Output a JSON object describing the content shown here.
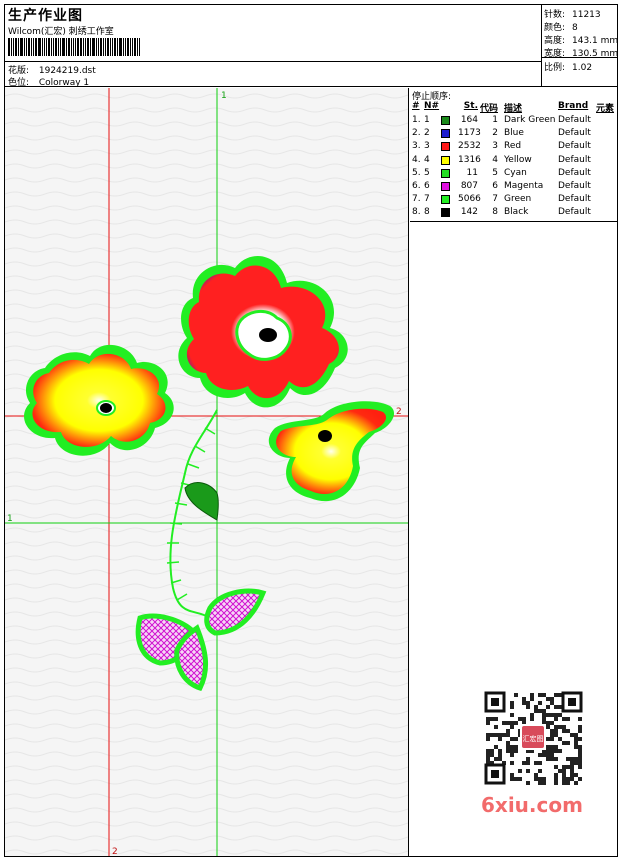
{
  "header": {
    "title": "生产作业图",
    "studio": "Wilcom(汇宏) 刺绣工作室",
    "design_label": "花版:",
    "design_value": "1924219.dst",
    "colorway_label": "色位:",
    "colorway_value": "Colorway 1"
  },
  "stats": [
    {
      "label": "针数:",
      "value": "11213"
    },
    {
      "label": "颜色:",
      "value": "8"
    },
    {
      "label": "高度:",
      "value": "143.1 mm"
    },
    {
      "label": "宽度:",
      "value": "130.5 mm"
    },
    {
      "label": "比例:",
      "value": "1.02"
    }
  ],
  "stop_sequence": {
    "title": "停止顺序:",
    "columns": {
      "hash": "#",
      "n": "N#",
      "st": "St.",
      "code": "代码",
      "desc": "描述",
      "brand": "Brand",
      "elem": "元素"
    },
    "rows": [
      {
        "idx": "1.",
        "n": "1",
        "color": "#1a8a1a",
        "st": "164",
        "code": "1",
        "desc": "Dark Green",
        "brand": "Default"
      },
      {
        "idx": "2.",
        "n": "2",
        "color": "#1c1ccf",
        "st": "1173",
        "code": "2",
        "desc": "Blue",
        "brand": "Default"
      },
      {
        "idx": "3.",
        "n": "3",
        "color": "#ff1a1a",
        "st": "2532",
        "code": "3",
        "desc": "Red",
        "brand": "Default"
      },
      {
        "idx": "4.",
        "n": "4",
        "color": "#ffff00",
        "st": "1316",
        "code": "4",
        "desc": "Yellow",
        "brand": "Default"
      },
      {
        "idx": "5.",
        "n": "5",
        "color": "#22dd22",
        "st": "11",
        "code": "5",
        "desc": "Cyan",
        "brand": "Default"
      },
      {
        "idx": "6.",
        "n": "6",
        "color": "#e010e0",
        "st": "807",
        "code": "6",
        "desc": "Magenta",
        "brand": "Default"
      },
      {
        "idx": "7.",
        "n": "7",
        "color": "#22ee22",
        "st": "5066",
        "code": "7",
        "desc": "Green",
        "brand": "Default"
      },
      {
        "idx": "8.",
        "n": "8",
        "color": "#000000",
        "st": "142",
        "code": "8",
        "desc": "Black",
        "brand": "Default"
      }
    ]
  },
  "guides": {
    "v1": "1",
    "v2": "2",
    "h1": "1",
    "h2": "2"
  },
  "watermark": "6xiu.com",
  "qr_stamp": "汇宏图"
}
